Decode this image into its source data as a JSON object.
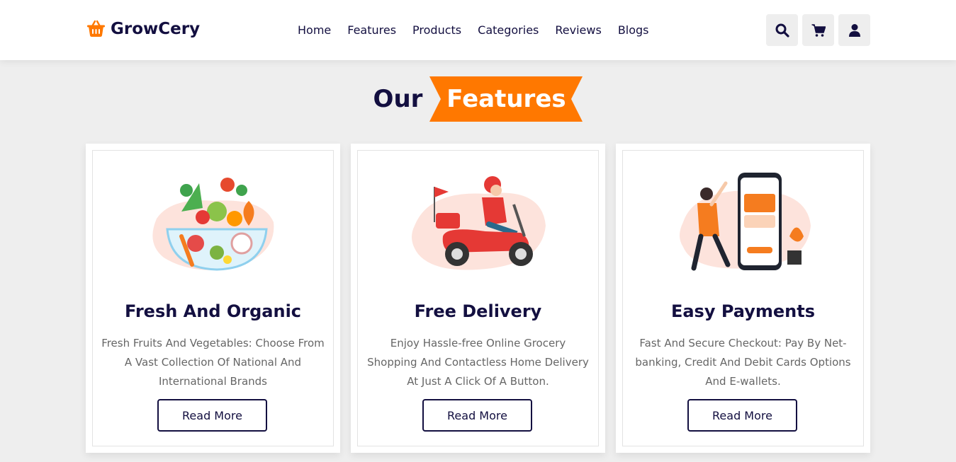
{
  "brand": {
    "name": "GrowCery",
    "accent": "#ff7800",
    "ink": "#130f40"
  },
  "nav": {
    "items": [
      {
        "label": "Home"
      },
      {
        "label": "Features"
      },
      {
        "label": "Products"
      },
      {
        "label": "Categories"
      },
      {
        "label": "Reviews"
      },
      {
        "label": "Blogs"
      }
    ]
  },
  "header_icons": [
    "search-icon",
    "cart-icon",
    "user-icon"
  ],
  "section": {
    "title_plain": "Our",
    "title_highlight": "Features"
  },
  "features": [
    {
      "title": "Fresh And Organic",
      "text": "Fresh Fruits And Vegetables: Choose From A Vast Collection Of National And International Brands",
      "button": "Read More",
      "illustration": "salad-bowl-illustration"
    },
    {
      "title": "Free Delivery",
      "text": "Enjoy Hassle-free Online Grocery Shopping And Contactless Home Delivery At Just A Click Of A Button.",
      "button": "Read More",
      "illustration": "delivery-scooter-illustration"
    },
    {
      "title": "Easy Payments",
      "text": "Fast And Secure Checkout: Pay By Net-banking, Credit And Debit Cards Options And E-wallets.",
      "button": "Read More",
      "illustration": "mobile-payment-illustration"
    }
  ]
}
